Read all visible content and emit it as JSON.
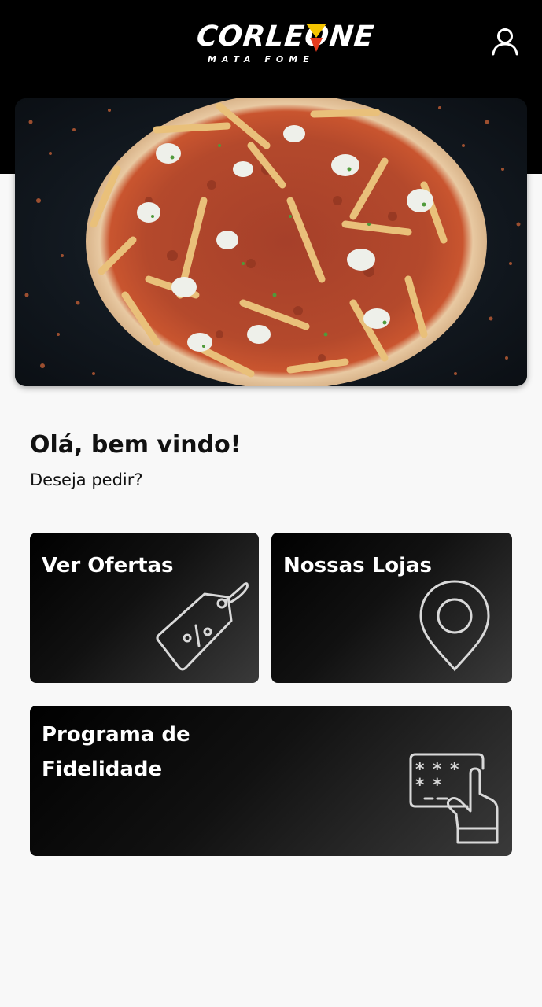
{
  "brand": {
    "name": "CORLEONE",
    "tagline": "MATA FOME",
    "accent_colors": [
      "#f5c400",
      "#e63b1e"
    ]
  },
  "header": {
    "account_icon": "user-icon"
  },
  "hero": {
    "image_icon": "pizza-with-fries-image"
  },
  "welcome": {
    "title": "Olá, bem vindo!",
    "subtitle": "Deseja pedir?"
  },
  "cards": {
    "offers": {
      "label": "Ver Ofertas",
      "icon": "discount-tag-icon"
    },
    "stores": {
      "label": "Nossas Lojas",
      "icon": "map-pin-icon"
    },
    "loyalty": {
      "label": "Programa de Fidelidade",
      "icon": "card-payment-icon"
    }
  }
}
